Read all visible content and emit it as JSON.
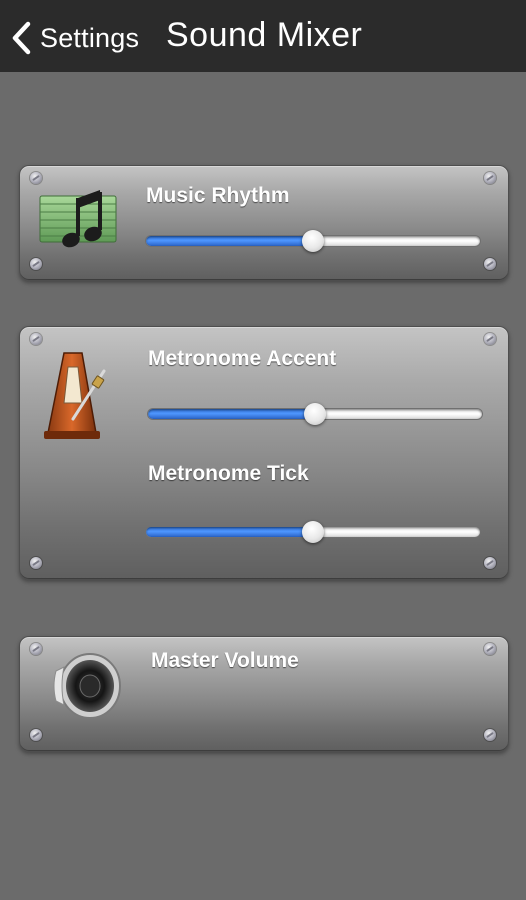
{
  "navbar": {
    "back_label": "Settings",
    "title": "Sound Mixer"
  },
  "panels": {
    "music": {
      "icon": "music-note-icon",
      "label": "Music Rhythm",
      "value": 0.5
    },
    "metronome": {
      "icon": "metronome-icon",
      "accent_label": "Metronome Accent",
      "accent_value": 0.5,
      "tick_label": "Metronome Tick",
      "tick_value": 0.5
    },
    "master": {
      "icon": "speaker-icon",
      "label": "Master Volume"
    }
  },
  "colors": {
    "navbar_bg": "#2b2b2b",
    "page_bg": "#6b6b6b",
    "slider_fill": "#3f86f0"
  }
}
